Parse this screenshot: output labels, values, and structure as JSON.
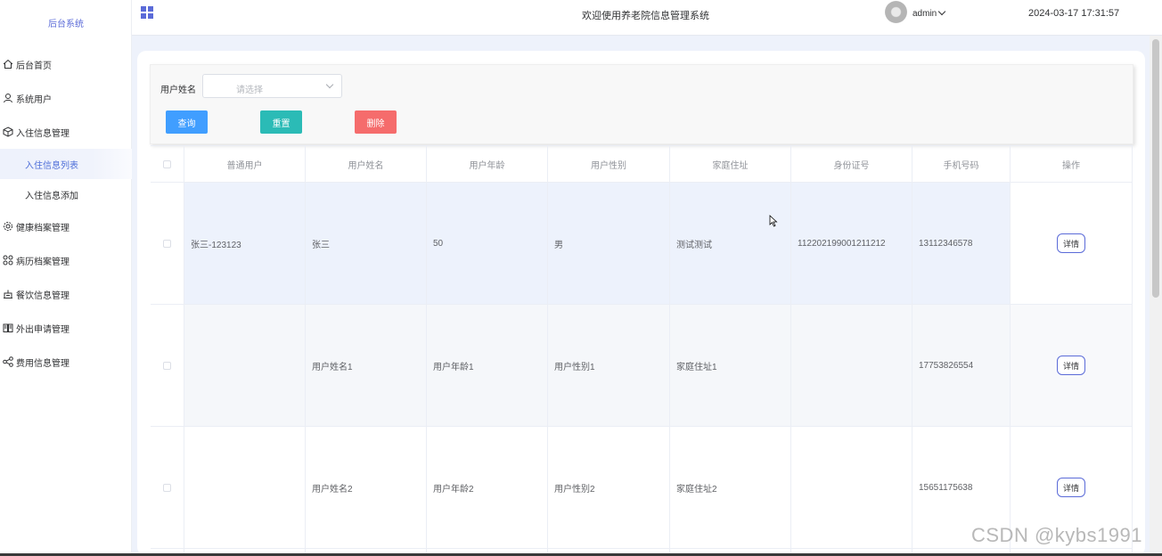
{
  "sidebar": {
    "brand": "后台系统",
    "items": [
      {
        "label": "后台首页",
        "icon": "home-icon"
      },
      {
        "label": "系统用户",
        "icon": "user-icon"
      },
      {
        "label": "入住信息管理",
        "icon": "box-icon"
      }
    ],
    "subitems": [
      {
        "label": "入住信息列表",
        "active": true
      },
      {
        "label": "入住信息添加",
        "active": false
      }
    ],
    "items2": [
      {
        "label": "健康档案管理",
        "icon": "gear-icon"
      },
      {
        "label": "病历档案管理",
        "icon": "grid-icon"
      },
      {
        "label": "餐饮信息管理",
        "icon": "dining-icon"
      },
      {
        "label": "外出申请管理",
        "icon": "book-icon"
      },
      {
        "label": "费用信息管理",
        "icon": "share-icon"
      }
    ]
  },
  "header": {
    "title": "欢迎使用养老院信息管理系统",
    "user": "admin",
    "datetime": "2024-03-17 17:31:57"
  },
  "search": {
    "label": "用户姓名",
    "placeholder": "请选择",
    "query_label": "查询",
    "reset_label": "重置",
    "delete_label": "删除"
  },
  "table": {
    "columns": [
      "普通用户",
      "用户姓名",
      "用户年龄",
      "用户性别",
      "家庭住址",
      "身份证号",
      "手机号码",
      "操作"
    ],
    "rows": [
      {
        "normal_user": "张三-123123",
        "name": "张三",
        "age": "50",
        "gender": "男",
        "address": "测试测试",
        "id_card": "112202199001211212",
        "phone": "13112346578",
        "action": "详情"
      },
      {
        "normal_user": "",
        "name": "用户姓名1",
        "age": "用户年龄1",
        "gender": "用户性别1",
        "address": "家庭住址1",
        "id_card": "",
        "phone": "17753826554",
        "action": "详情"
      },
      {
        "normal_user": "",
        "name": "用户姓名2",
        "age": "用户年龄2",
        "gender": "用户性别2",
        "address": "家庭住址2",
        "id_card": "",
        "phone": "15651175638",
        "action": "详情"
      }
    ]
  },
  "colors": {
    "accent": "#5b6bd8",
    "query": "#409eff",
    "reset": "#2bbbb6",
    "delete": "#f56c6c"
  },
  "watermark": "CSDN @kybs1991"
}
